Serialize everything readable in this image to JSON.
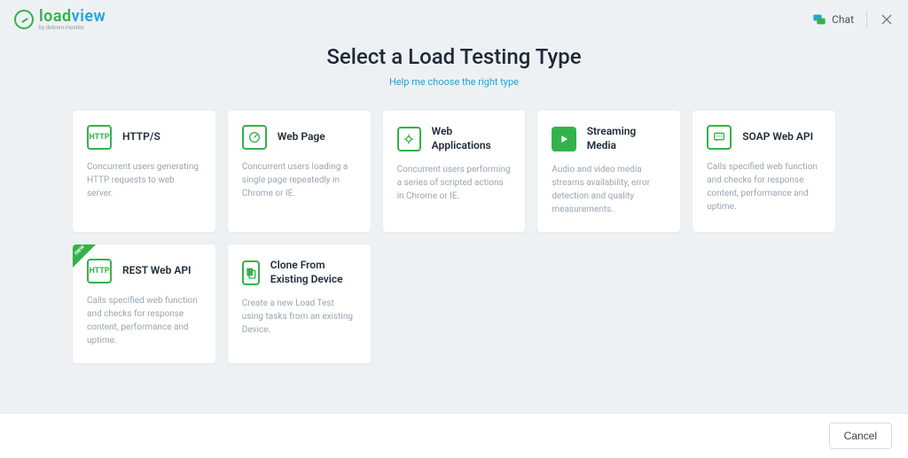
{
  "brand": {
    "name_part1": "load",
    "name_part2": "view",
    "tagline": "by dotcom-monitor"
  },
  "header": {
    "chat_label": "Chat"
  },
  "page": {
    "title": "Select a Load Testing Type",
    "help_link": "Help me choose the right type"
  },
  "cards": [
    {
      "title": "HTTP/S",
      "desc": "Concurrent users generating HTTP requests to web server.",
      "icon": "http",
      "new": false
    },
    {
      "title": "Web Page",
      "desc": "Concurrent users loading a single page repeatedly in Chrome or IE.",
      "icon": "gauge",
      "new": false
    },
    {
      "title": "Web Applications",
      "desc": "Concurrent users performing a series of scripted actions in Chrome or IE.",
      "icon": "gear",
      "new": false
    },
    {
      "title": "Streaming Media",
      "desc": "Audio and video media streams availability, error detection and quality measurements.",
      "icon": "play",
      "new": false
    },
    {
      "title": "SOAP Web API",
      "desc": "Calls specified web function and checks for response content, performance and uptime.",
      "icon": "chat",
      "new": false
    },
    {
      "title": "REST Web API",
      "desc": "Calls specified web function and checks for response content, performance and uptime.",
      "icon": "http",
      "new": true
    },
    {
      "title": "Clone From Existing Device",
      "desc": "Create a new Load Test using tasks from an existing Device.",
      "icon": "clone",
      "new": false
    }
  ],
  "badge": {
    "new_label": "new"
  },
  "footer": {
    "cancel": "Cancel"
  }
}
